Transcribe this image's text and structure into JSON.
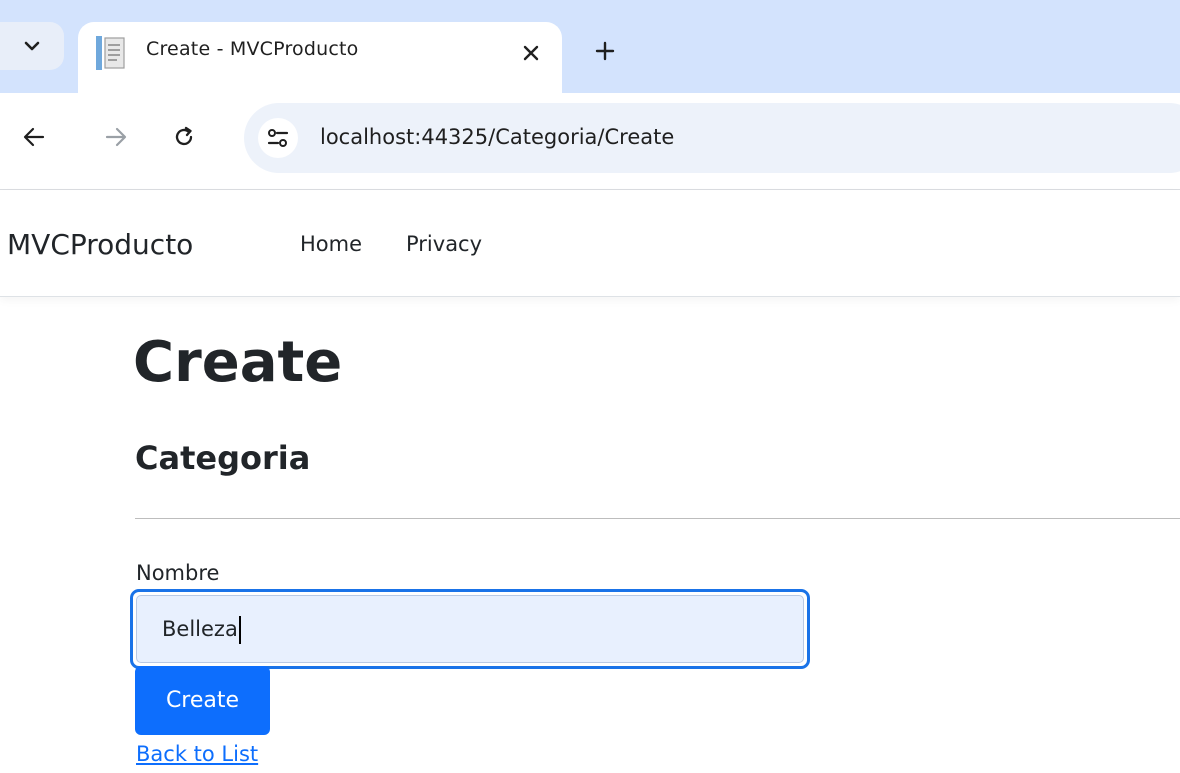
{
  "browser": {
    "tab_title": "Create - MVCProducto",
    "url": "localhost:44325/Categoria/Create",
    "icons": {
      "tab_dropdown": "chevron-down-icon",
      "favicon": "page-icon",
      "close": "close-icon",
      "new_tab": "plus-icon",
      "back": "arrow-left-icon",
      "forward": "arrow-right-icon",
      "reload": "reload-icon",
      "site_info": "tune-icon"
    }
  },
  "navbar": {
    "brand": "MVCProducto",
    "links": [
      "Home",
      "Privacy"
    ]
  },
  "page": {
    "title": "Create",
    "subtitle": "Categoria",
    "form": {
      "label": "Nombre",
      "value": "Belleza",
      "submit_label": "Create"
    },
    "back_link": "Back to List"
  },
  "colors": {
    "primary": "#0d6efd",
    "focus_ring": "#1a73e8",
    "tabstrip": "#d3e3fd",
    "omnibox": "#edf2fa",
    "autofill": "#e8f0fe"
  }
}
